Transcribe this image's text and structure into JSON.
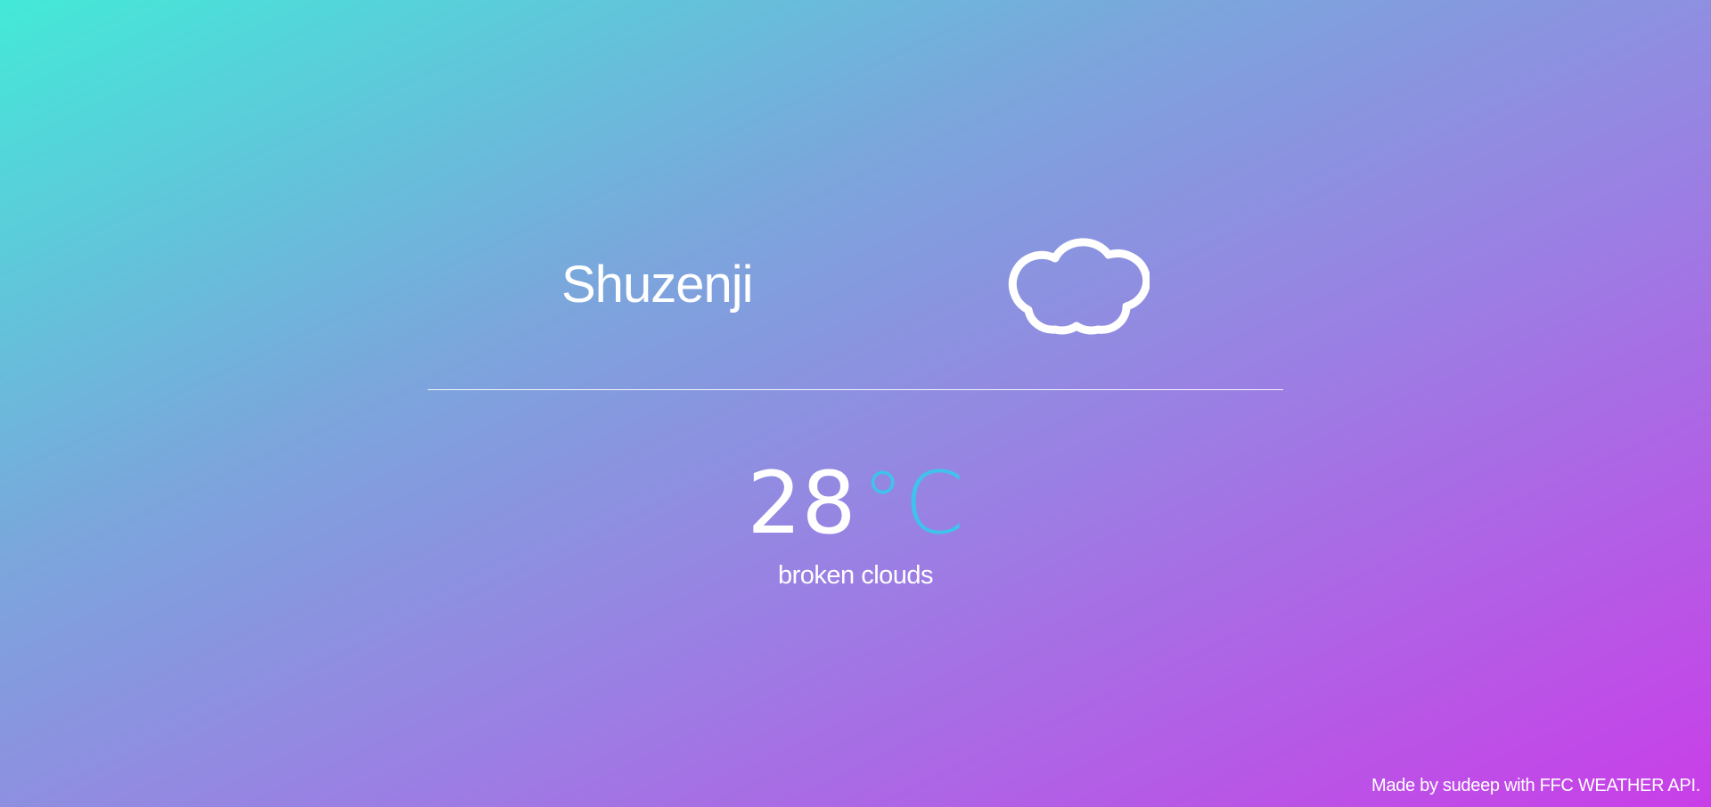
{
  "location": {
    "city": "Shuzenji"
  },
  "weather": {
    "icon": "cloud-icon",
    "temperature": "28",
    "unit": "°C",
    "description": "broken clouds"
  },
  "footer": {
    "credit": "Made by sudeep with FFC WEATHER API."
  },
  "colors": {
    "gradient_start": "#43e9d8",
    "gradient_end": "#c93ee8",
    "unit_accent": "#3fc3ec",
    "text": "#ffffff"
  }
}
